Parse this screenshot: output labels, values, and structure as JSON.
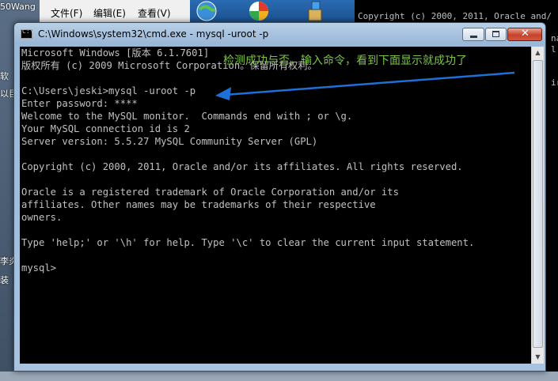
{
  "background": {
    "left_edge_texts": [
      "50Wang",
      "软",
      "以目",
      "李炎",
      "装"
    ],
    "explorer_menu": [
      "文件(F)",
      "编辑(E)",
      "查看(V)"
    ],
    "console_lines": [
      "Copyright (c) 2000, 2011, Oracle and/",
      "na",
      "l",
      "ir"
    ]
  },
  "window": {
    "title": "C:\\Windows\\system32\\cmd.exe - mysql  -uroot -p",
    "controls": {
      "minimize": "minimize",
      "maximize": "maximize",
      "close": "close"
    }
  },
  "console": {
    "lines": [
      "Microsoft Windows [版本 6.1.7601]",
      "版权所有 (c) 2009 Microsoft Corporation。保留所有权利。",
      "",
      "C:\\Users\\jeski>mysql -uroot -p",
      "Enter password: ****",
      "Welcome to the MySQL monitor.  Commands end with ; or \\g.",
      "Your MySQL connection id is 2",
      "Server version: 5.5.27 MySQL Community Server (GPL)",
      "",
      "Copyright (c) 2000, 2011, Oracle and/or its affiliates. All rights reserved.",
      "",
      "Oracle is a registered trademark of Oracle Corporation and/or its",
      "affiliates. Other names may be trademarks of their respective",
      "owners.",
      "",
      "Type 'help;' or '\\h' for help. Type '\\c' to clear the current input statement.",
      "",
      "mysql>"
    ]
  },
  "annotation": {
    "text": "检测成功与否，输入命令，看到下面显示就成功了",
    "color": "#7cc24a",
    "arrow_color": "#1e6fd6"
  }
}
